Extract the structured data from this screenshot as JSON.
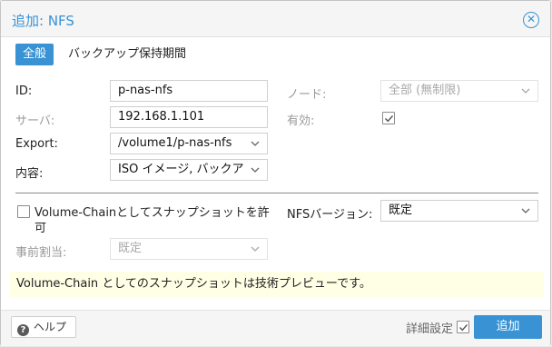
{
  "dialog": {
    "title": "追加: NFS",
    "close_icon": "close-circle-icon"
  },
  "tabs": [
    {
      "label": "全般",
      "active": true
    },
    {
      "label": "バックアップ保持期間",
      "active": false
    }
  ],
  "left": {
    "id_label": "ID:",
    "id_value": "p-nas-nfs",
    "server_label": "サーバ:",
    "server_value": "192.168.1.101",
    "export_label": "Export:",
    "export_value": "/volume1/p-nas-nfs",
    "content_label": "内容:",
    "content_value": "ISO イメージ, バックア"
  },
  "right": {
    "node_label": "ノード:",
    "node_value": "全部 (無制限)",
    "enabled_label": "有効:",
    "enabled_checked": true
  },
  "advanced": {
    "volume_chain_label_line1": "Volume-Chainとしてスナップショットを許",
    "volume_chain_label_line2": "可",
    "volume_chain_checked": false,
    "prealloc_label": "事前割当:",
    "prealloc_value": "既定",
    "nfs_version_label": "NFSバージョン:",
    "nfs_version_value": "既定"
  },
  "notice": {
    "bold": "Volume-Chain",
    "text": " としてのスナップショットは技術プレビューです。"
  },
  "footer": {
    "help_label": "ヘルプ",
    "advanced_label": "詳細設定",
    "advanced_checked": true,
    "add_label": "追加"
  },
  "colors": {
    "accent": "#3892d4",
    "notice_bg": "#ffffe6",
    "disabled_text": "#9a9a9a"
  }
}
